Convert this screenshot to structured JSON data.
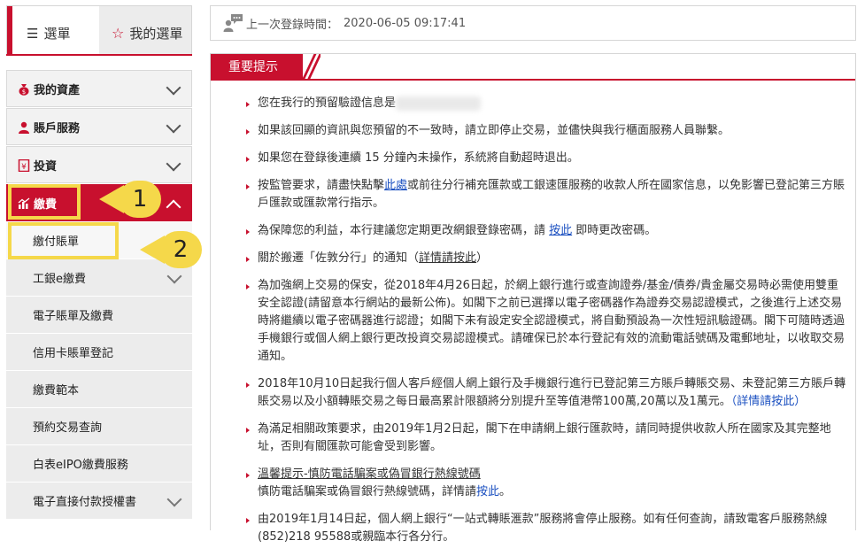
{
  "sidebar": {
    "tabs": [
      {
        "label": "選單",
        "icon": "list-icon",
        "active": true
      },
      {
        "label": "我的選單",
        "icon": "star-icon",
        "active": false
      }
    ],
    "menu": [
      {
        "label": "我的資產",
        "icon": "money-bag-icon"
      },
      {
        "label": "賬戶服務",
        "icon": "user-icon"
      },
      {
        "label": "投資",
        "icon": "yuan-doc-icon"
      },
      {
        "label": "繳費",
        "icon": "chart-icon",
        "active": true
      }
    ],
    "submenu": [
      {
        "label": "繳付賬單",
        "selected": true
      },
      {
        "label": "工銀e繳費",
        "expandable": true
      },
      {
        "label": "電子賬單及繳費"
      },
      {
        "label": "信用卡賬單登記"
      },
      {
        "label": "繳費範本"
      },
      {
        "label": "預約交易查詢"
      },
      {
        "label": "白表eIPO繳費服務"
      },
      {
        "label": "電子直接付款授權書",
        "expandable": true
      }
    ]
  },
  "annotations": {
    "callout_1": "1",
    "callout_2": "2",
    "highlight_color": "#f5d84a"
  },
  "login": {
    "label": "上一次登錄時間：",
    "time": "2020-06-05 09:17:41"
  },
  "notice": {
    "title": "重要提示",
    "items": [
      {
        "text": "您在我行的預留驗證信息是"
      },
      {
        "text": "如果該回顯的資訊與您預留的不一致時，請立即停止交易，並儘快與我行櫃面服務人員聯繫。"
      },
      {
        "text": "如果您在登錄後連續 15 分鐘內未操作，系統將自動超時退出。"
      },
      {
        "pre": "按監管要求，請盡快點擊",
        "link": "此處",
        "post": "或前往分行補充匯款或工銀速匯服務的收款人所在國家信息，以免影響已登記第三方賬戶匯款或匯款常行指示。"
      },
      {
        "pre": "為保障您的利益，本行建議您定期更改網銀登錄密碼，請 ",
        "link": "按此",
        "post": " 即時更改密碼。"
      },
      {
        "pre": "關於搬遷「佐敦分行」的通知（",
        "link": "詳情請按此",
        "post": "）"
      },
      {
        "text": "為加強網上交易的保安，從2018年4月26日起，於網上銀行進行或查詢證券/基金/債券/貴金屬交易時必需使用雙重安全認證(請留意本行網站的最新公佈)。如閣下之前已選擇以電子密碼器作為證券交易認證模式，之後進行上述交易時將繼續以電子密碼器進行認證；如閣下未有設定安全認證模式，將自動預設為一次性短訊驗證碼。閣下可隨時透過手機銀行或個人網上銀行更改投資交易認證模式。請確保已於本行登記有效的流動電話號碼及電郵地址，以收取交易通知。"
      },
      {
        "pre": "2018年10月10日起我行個人客戶經個人網上銀行及手機銀行進行已登記第三方賬戶轉賬交易、未登記第三方賬戶轉賬交易以及小額轉賬交易之每日最高累計限額將分別提升至等值港幣100萬,20萬以及1萬元。",
        "link": "（詳情請按此）",
        "post": ""
      },
      {
        "text": "為滿足相關政策要求，由2019年1月2日起，閣下在申請網上銀行匯款時，請同時提供收款人所在國家及其完整地址，否則有關匯款可能會受到影響。"
      },
      {
        "heading": "溫馨提示-慎防電話騙案或偽冒銀行熱線號碼",
        "pre": "慎防電話騙案或偽冒銀行熱線號碼，詳情請",
        "link": "按此",
        "post": "。"
      },
      {
        "text": "由2019年1月14日起，個人網上銀行“一站式轉賬滙款”服務將會停止服務。如有任何查詢，請致電客戶服務熱線(852)218 95588或親臨本行各分行。"
      }
    ]
  }
}
